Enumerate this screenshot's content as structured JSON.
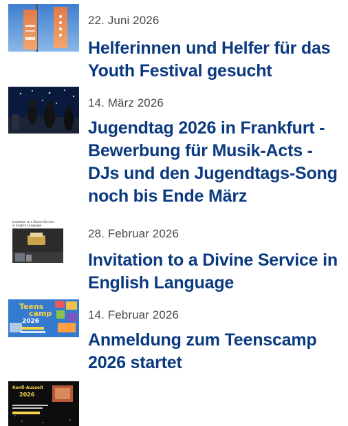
{
  "news": {
    "items": [
      {
        "date": "22. Juni 2026",
        "title": "Helferinnen und Helfer für das Youth Festival gesucht",
        "thumbnail": "youth-festival-banners-image"
      },
      {
        "date": "14. März 2026",
        "title": "Jugendtag 2026 in Frankfurt - Bewerbung für Musik-Acts - DJs und den Jugendtags-Song noch bis Ende März",
        "thumbnail": "concert-stage-image"
      },
      {
        "date": "28. Februar 2026",
        "title": "Invitation to a Divine Service in English Language",
        "thumbnail": "divine-service-flyer-image",
        "thumbnail_caption": "Invitation to a Divine Service in English Language"
      },
      {
        "date": "14. Februar 2026",
        "title": "Anmeldung zum Teenscamp 2026 startet",
        "thumbnail": "teenscamp-poster-image",
        "thumbnail_text": {
          "line1": "Teens",
          "line2": "camp",
          "year": "2026"
        }
      },
      {
        "thumbnail": "konfi-auszeit-poster-image",
        "thumbnail_text": {
          "heading": "Konfi-Auszeit",
          "year": "2026"
        }
      }
    ]
  },
  "colors": {
    "title": "#0b3a80",
    "date": "#4a4a4a",
    "background": "#ffffff"
  }
}
